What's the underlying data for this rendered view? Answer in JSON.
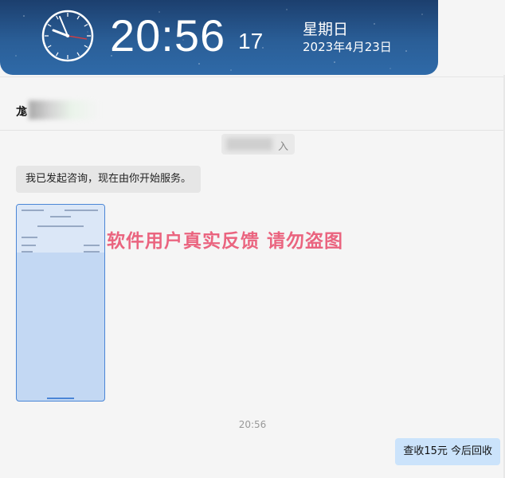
{
  "clock": {
    "time": "20:56",
    "seconds": "17",
    "weekday": "星期日",
    "date": "2023年4月23日"
  },
  "chat": {
    "contact_name_visible": "尨",
    "system_notice_suffix": "入",
    "messages": [
      {
        "side": "left",
        "type": "text",
        "text": "我已发起咨询，现在由你开始服务。"
      },
      {
        "side": "left",
        "type": "image"
      }
    ],
    "watermark": "软件用户真实反馈  请勿盗图",
    "timestamp": "20:56",
    "reply": "查收15元  今后回收"
  },
  "colors": {
    "clock_bg": "#2a5e97",
    "watermark": "#e94b6b",
    "reply_bubble": "#cbe3fb",
    "left_bubble": "#e6e6e6"
  }
}
